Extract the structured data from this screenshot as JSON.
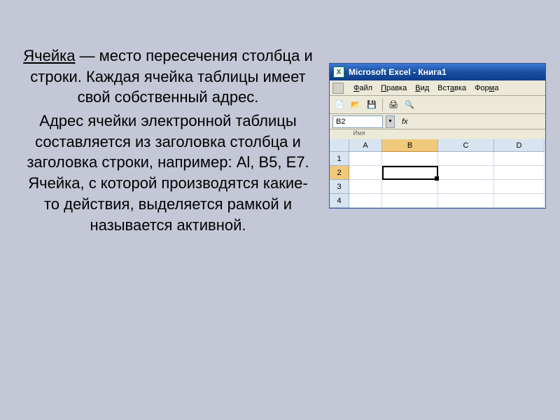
{
  "text": {
    "term": "Ячейка",
    "para1_rest": " — место пересечения столбца и строки. Каждая ячейка таблицы имеет свой собственный адрес.",
    "para2": "Адрес ячейки электронной таблицы составляется из заголовка столбца и заголовка строки, например: Al, B5, E7. Ячейка, с которой производятся какие-то действия, выделяется рамкой и называется активной."
  },
  "excel": {
    "title": "Microsoft Excel - Книга1",
    "menu": {
      "file": "Файл",
      "edit": "Правка",
      "view": "Вид",
      "insert": "Вставка",
      "format": "Форма"
    },
    "namebox": "B2",
    "fx": "fx",
    "name_label": "Имя",
    "columns": [
      "A",
      "B",
      "C",
      "D"
    ],
    "rows": [
      "1",
      "2",
      "3",
      "4"
    ]
  }
}
